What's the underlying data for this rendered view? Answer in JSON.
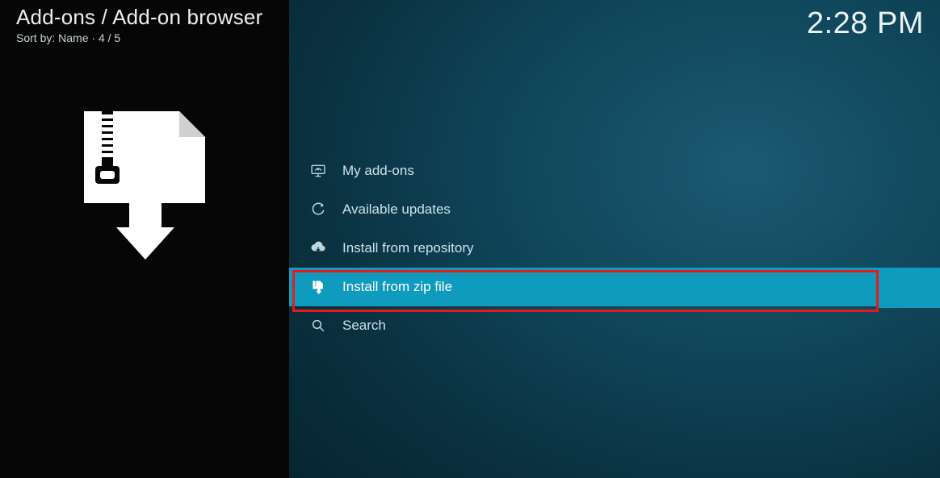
{
  "header": {
    "breadcrumb": "Add-ons / Add-on browser",
    "sort_prefix": "Sort by: ",
    "sort_value": "Name",
    "separator": "  ·  ",
    "counter": "4 / 5"
  },
  "clock": "2:28 PM",
  "menu": {
    "items": [
      {
        "label": "My add-ons",
        "icon": "monitor-icon"
      },
      {
        "label": "Available updates",
        "icon": "refresh-icon"
      },
      {
        "label": "Install from repository",
        "icon": "cloud-download-icon"
      },
      {
        "label": "Install from zip file",
        "icon": "zip-download-icon"
      },
      {
        "label": "Search",
        "icon": "search-icon"
      }
    ]
  }
}
